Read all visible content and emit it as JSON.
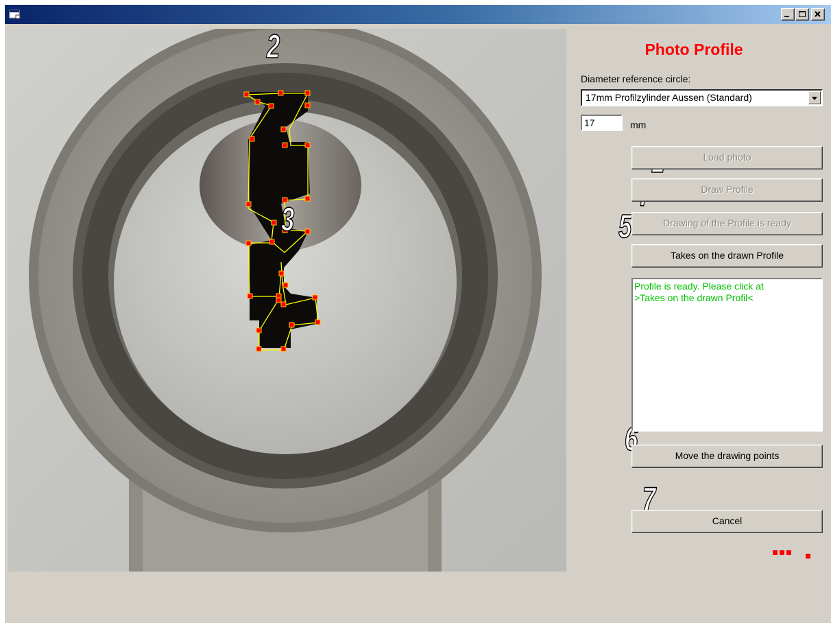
{
  "window": {
    "icon": "app-window-icon",
    "controls": [
      "minimize-icon",
      "maximize-icon",
      "close-icon"
    ]
  },
  "panel": {
    "title": "Photo Profile",
    "diameter_label": "Diameter reference circle:",
    "diameter_select_value": "17mm Profilzylinder Aussen (Standard)",
    "diameter_value": "17",
    "unit": "mm"
  },
  "buttons": {
    "load_photo": "Load photo",
    "draw_profile": "Draw Profile",
    "drawing_ready": "Drawing of the Profile is ready",
    "takes_profile": "Takes on the drawn Profile",
    "move_points": "Move the drawing points",
    "cancel": "Cancel"
  },
  "status_log": {
    "lines": [
      "Profile is ready. Please click at",
      ">Takes on the drawn Profil<"
    ],
    "color": "#00c000"
  },
  "step_markers": [
    "1",
    "2",
    "3",
    "4",
    "5",
    "6",
    "7"
  ],
  "colors": {
    "title": "#ff0000",
    "titlebar_start": "#0a246a",
    "titlebar_end": "#a6caf0",
    "profile_line": "#ffff00",
    "profile_point": "#ff0000"
  }
}
